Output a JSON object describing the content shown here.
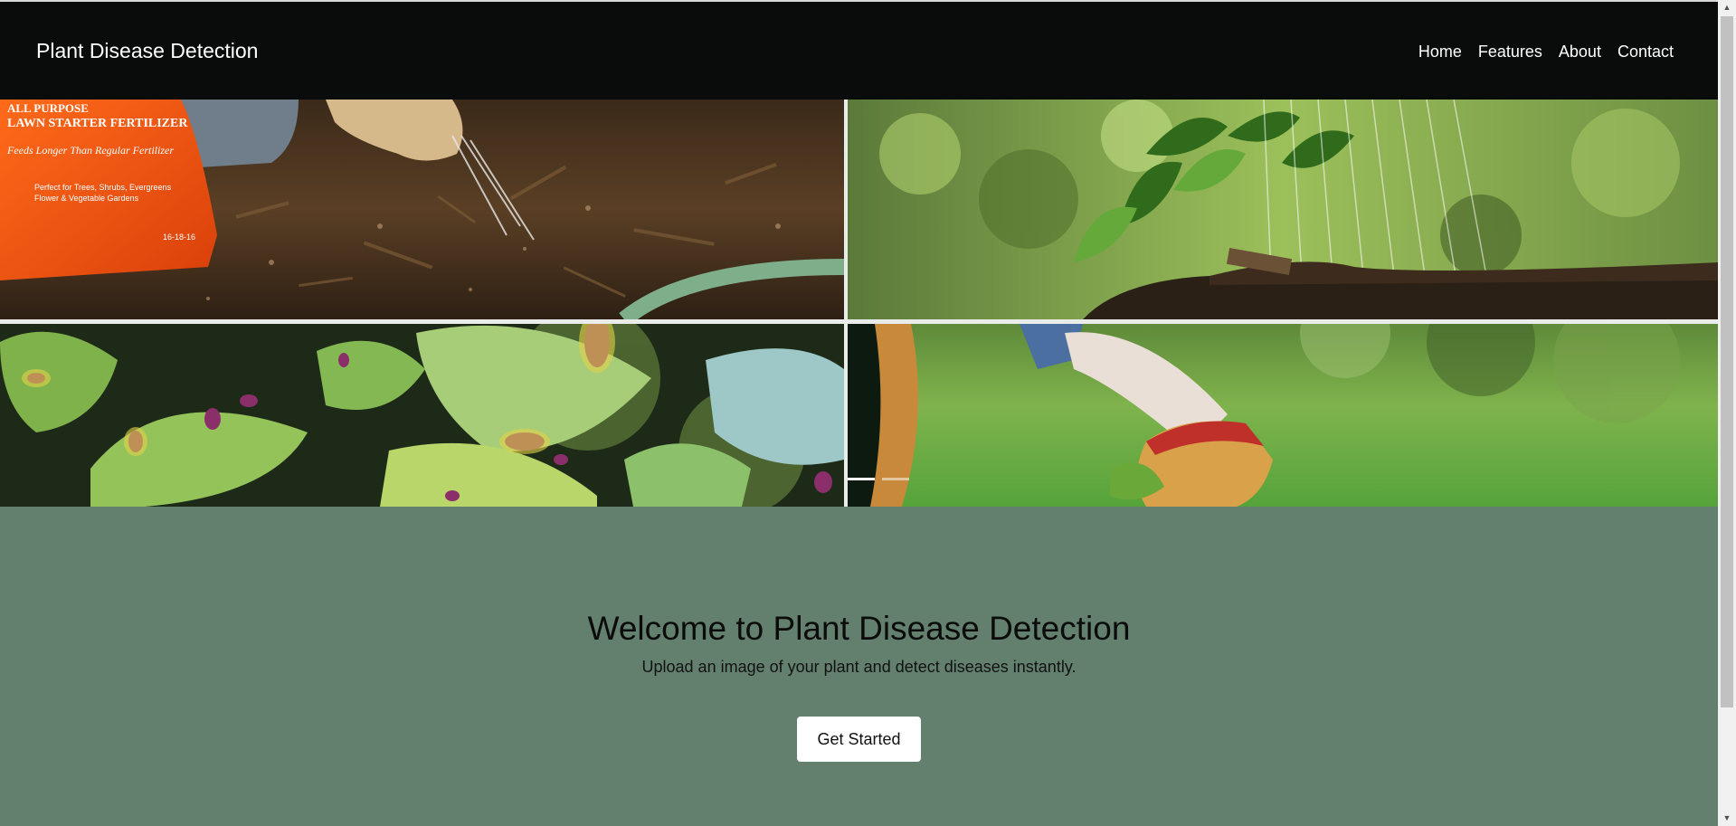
{
  "navbar": {
    "brand": "Plant Disease Detection",
    "links": [
      "Home",
      "Features",
      "About",
      "Contact"
    ]
  },
  "carousel": {
    "slides": [
      {
        "content": "fertilizer-spreading-photo",
        "bag_text": [
          "ALL PURPOSE",
          "LAWN STARTER FERTILIZER",
          "Feeds Longer Than Regular Fertilizer",
          "Perfect for Trees, Shrubs, Evergreens",
          "Flower & Vegetable Gardens",
          "16-18-16"
        ]
      },
      {
        "content": "watering-seedlings-photo"
      },
      {
        "content": "diseased-leaves-photo"
      },
      {
        "content": "gloved-hand-lawn-photo"
      }
    ],
    "indicators": [
      true,
      false
    ],
    "colors": {
      "indicator_active": "#ffffff",
      "indicator_inactive": "rgba(255,255,255,0.5)"
    }
  },
  "hero": {
    "title": "Welcome to Plant Disease Detection",
    "subtitle": "Upload an image of your plant and detect diseases instantly.",
    "cta_label": "Get Started"
  },
  "scrollbar": {
    "up_icon": "▲",
    "down_icon": "▼"
  },
  "theme": {
    "navbar_bg": "#0a0c0b",
    "hero_bg": "#63806e",
    "button_bg": "#ffffff",
    "text_light": "#ffffff",
    "text_dark": "#0b0b0b"
  }
}
